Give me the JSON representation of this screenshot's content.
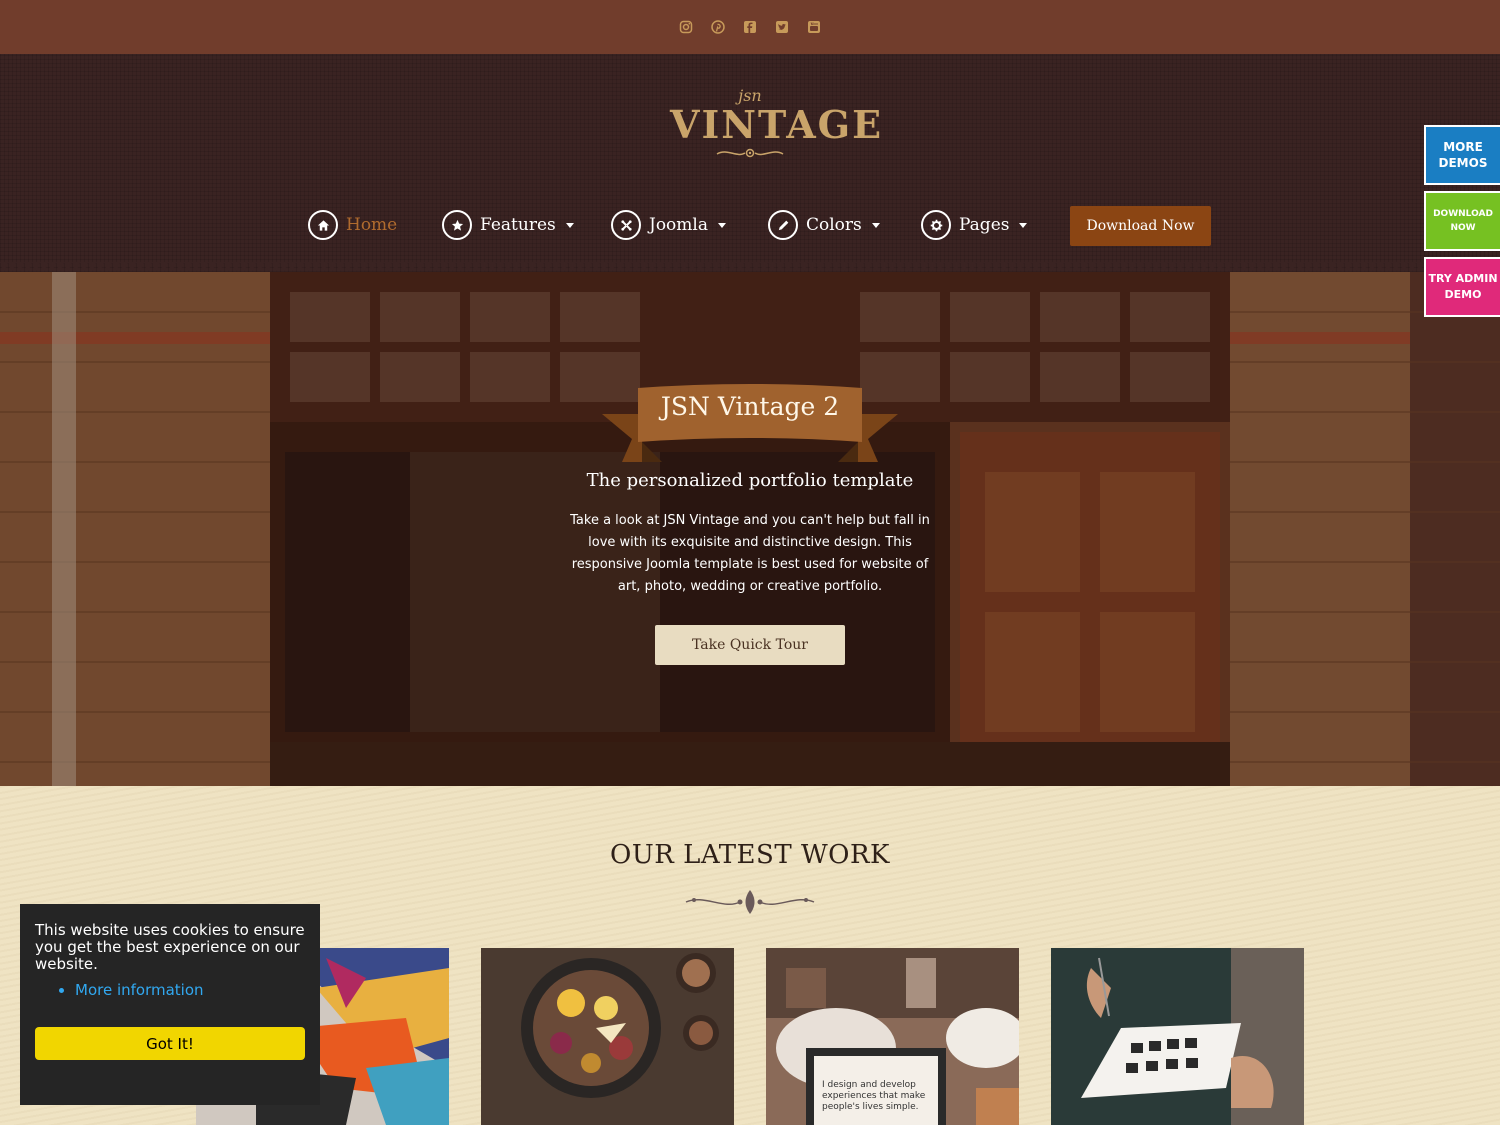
{
  "topbar": {
    "social_icons": [
      "instagram-icon",
      "pinterest-icon",
      "facebook-icon",
      "twitter-icon",
      "youtube-icon"
    ]
  },
  "logo": {
    "small": "jsn",
    "big": "VINTAGE"
  },
  "nav": {
    "items": [
      {
        "label": "Home",
        "icon": "home-icon",
        "active": true,
        "dropdown": false
      },
      {
        "label": "Features",
        "icon": "star-icon",
        "active": false,
        "dropdown": true
      },
      {
        "label": "Joomla",
        "icon": "joomla-icon",
        "active": false,
        "dropdown": true
      },
      {
        "label": "Colors",
        "icon": "pencil-icon",
        "active": false,
        "dropdown": true
      },
      {
        "label": "Pages",
        "icon": "gear-icon",
        "active": false,
        "dropdown": true
      }
    ],
    "download_label": "Download Now"
  },
  "sidetabs": {
    "more_demos": "MORE DEMOS",
    "download_now": "DOWNLOAD NOW",
    "try_admin": "TRY ADMIN DEMO"
  },
  "hero": {
    "title": "JSN Vintage 2",
    "subtitle": "The personalized portfolio template",
    "description": "Take a look at JSN Vintage and you can't help but fall in love with its exquisite and distinctive design. This responsive Joomla template is best used for website of art, photo, wedding or creative portfolio.",
    "button": "Take Quick Tour"
  },
  "latest": {
    "title": "OUR LATEST WORK",
    "thumbnails": [
      "colorful-mural-image",
      "food-platter-image",
      "laptop-workspace-image",
      "sketching-hand-image"
    ],
    "laptop_text": "I design and develop experiences that make people's lives simple."
  },
  "cookie": {
    "message": "This website uses cookies to ensure you get the best experience on our website.",
    "link": "More information",
    "button": "Got It!"
  },
  "colors": {
    "topbar": "#713d2c",
    "header": "#3a2322",
    "accent": "#8b4513",
    "active_nav": "#b06b2e",
    "tab_more": "#1a7ec3",
    "tab_download": "#76c122",
    "tab_admin": "#e0297a",
    "cookie_button": "#f1d600"
  }
}
